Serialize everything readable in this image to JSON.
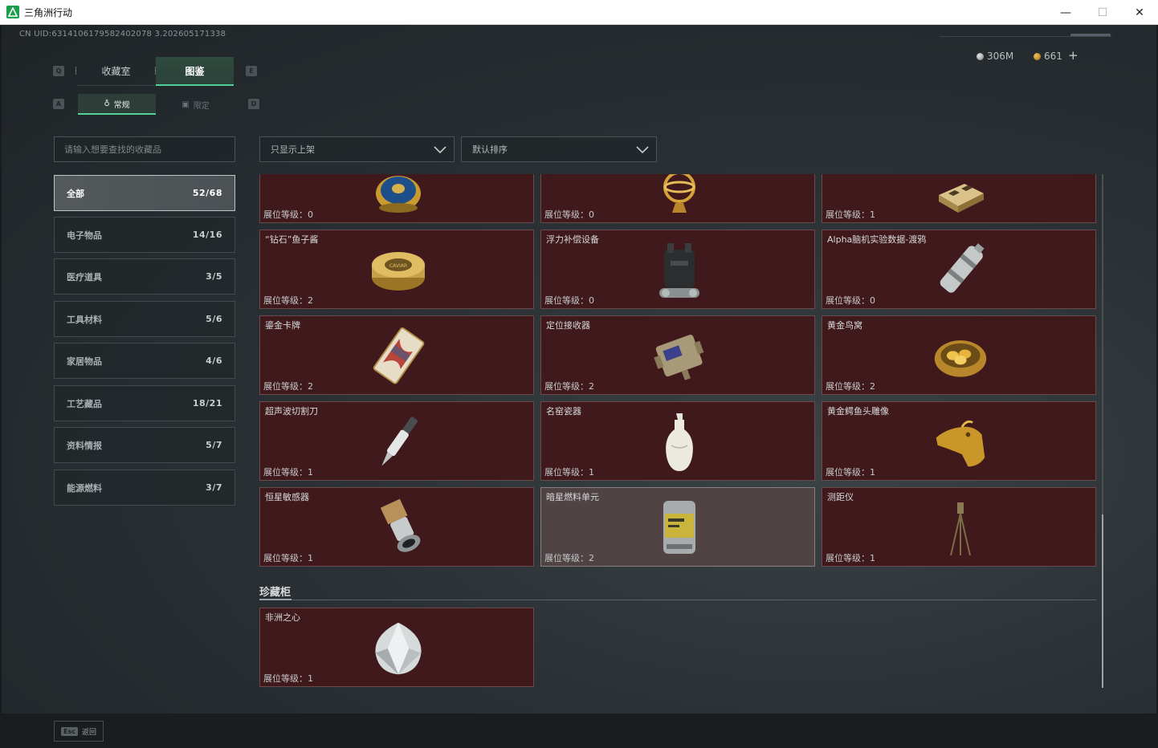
{
  "window": {
    "title": "三角洲行动",
    "minimize": "—",
    "maximize": "☐",
    "close": "✕"
  },
  "header": {
    "uid": "CN UID:6314106179582402078 3.202605171338",
    "currency_silver": "306M",
    "currency_gold": "661",
    "add": "+"
  },
  "keys": {
    "q": "Q",
    "e": "E",
    "a": "A",
    "d": "D"
  },
  "tabs": [
    {
      "label": "收藏室"
    },
    {
      "label": "图鉴"
    }
  ],
  "subtabs": [
    {
      "label": "常规"
    },
    {
      "label": "限定"
    }
  ],
  "search": {
    "placeholder": "请输入想要查找的收藏品"
  },
  "filters": {
    "shelf": "只显示上架",
    "sort": "默认排序"
  },
  "categories": [
    {
      "label": "全部",
      "count": "52/68",
      "active": true
    },
    {
      "label": "电子物品",
      "count": "14/16"
    },
    {
      "label": "医疗道具",
      "count": "3/5"
    },
    {
      "label": "工具材料",
      "count": "5/6"
    },
    {
      "label": "家居物品",
      "count": "4/6"
    },
    {
      "label": "工艺藏品",
      "count": "18/21"
    },
    {
      "label": "资料情报",
      "count": "5/7"
    },
    {
      "label": "能源燃料",
      "count": "3/7"
    }
  ],
  "items": [
    {
      "name": "",
      "level": "展位等级：0",
      "icon": "jeweled-egg-icon"
    },
    {
      "name": "",
      "level": "展位等级：0",
      "icon": "golden-globe-icon"
    },
    {
      "name": "",
      "level": "展位等级：1",
      "icon": "chess-box-icon"
    },
    {
      "name": "“钻石”鱼子酱",
      "level": "展位等级：2",
      "icon": "caviar-tin-icon"
    },
    {
      "name": "浮力补偿设备",
      "level": "展位等级：0",
      "icon": "buoyancy-device-icon"
    },
    {
      "name": "Alpha脑机实验数据-渡鸦",
      "level": "展位等级：0",
      "icon": "data-canister-icon"
    },
    {
      "name": "鎏金卡牌",
      "level": "展位等级：2",
      "icon": "gilded-card-icon"
    },
    {
      "name": "定位接收器",
      "level": "展位等级：2",
      "icon": "locator-receiver-icon"
    },
    {
      "name": "黄金鸟窝",
      "level": "展位等级：2",
      "icon": "golden-nest-icon"
    },
    {
      "name": "超声波切割刀",
      "level": "展位等级：1",
      "icon": "ultrasonic-knife-icon"
    },
    {
      "name": "名窑瓷器",
      "level": "展位等级：1",
      "icon": "porcelain-vase-icon"
    },
    {
      "name": "黄金鳄鱼头雕像",
      "level": "展位等级：1",
      "icon": "gold-crocodile-head-icon"
    },
    {
      "name": "恒星敏感器",
      "level": "展位等级：1",
      "icon": "star-sensor-icon"
    },
    {
      "name": "暗星燃料单元",
      "level": "展位等级：2",
      "icon": "fuel-cell-icon",
      "highlighted": true
    },
    {
      "name": "测距仪",
      "level": "展位等级：1",
      "icon": "rangefinder-tripod-icon"
    }
  ],
  "treasure": {
    "title": "珍藏柜",
    "items": [
      {
        "name": "非洲之心",
        "level": "展位等级：1",
        "icon": "diamond-icon"
      }
    ]
  },
  "footer": {
    "esc_key": "Esc",
    "esc_label": "返回"
  },
  "colors": {
    "accent": "#4fd19a",
    "card_bg": "#40191c",
    "card_border": "#6b4a4c"
  }
}
